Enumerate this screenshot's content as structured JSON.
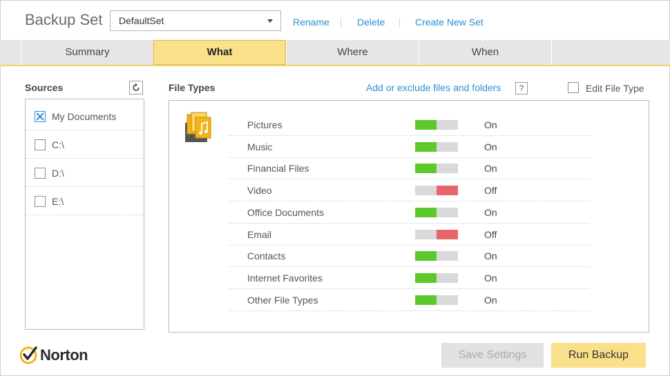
{
  "header": {
    "title": "Backup Set",
    "backup_set_selected": "DefaultSet",
    "links": {
      "rename": "Rename",
      "delete": "Delete",
      "create_new_set": "Create New Set"
    }
  },
  "tabs": [
    {
      "label": "Summary",
      "active": false
    },
    {
      "label": "What",
      "active": true
    },
    {
      "label": "Where",
      "active": false
    },
    {
      "label": "When",
      "active": false
    }
  ],
  "sources": {
    "heading": "Sources",
    "refresh_icon": "refresh-icon",
    "items": [
      {
        "label": "My Documents",
        "checked": true
      },
      {
        "label": "C:\\",
        "checked": false
      },
      {
        "label": "D:\\",
        "checked": false
      },
      {
        "label": "E:\\",
        "checked": false
      }
    ]
  },
  "file_types": {
    "heading": "File Types",
    "add_exclude_link": "Add or exclude files and folders",
    "help_label": "?",
    "edit_file_type_label": "Edit File Type",
    "icon": "documents-music-icon",
    "rows": [
      {
        "name": "Pictures",
        "state": "On"
      },
      {
        "name": "Music",
        "state": "On"
      },
      {
        "name": "Financial Files",
        "state": "On"
      },
      {
        "name": "Video",
        "state": "Off"
      },
      {
        "name": "Office Documents",
        "state": "On"
      },
      {
        "name": "Email",
        "state": "Off"
      },
      {
        "name": "Contacts",
        "state": "On"
      },
      {
        "name": "Internet Favorites",
        "state": "On"
      },
      {
        "name": "Other File Types",
        "state": "On"
      }
    ]
  },
  "footer": {
    "brand": "Norton",
    "save_settings_label": "Save Settings",
    "run_backup_label": "Run Backup"
  },
  "colors": {
    "accent_yellow": "#fbe08b",
    "link_blue": "#2a8fd0",
    "toggle_on_green": "#5bc92a",
    "toggle_off_red": "#e8666a",
    "norton_check": "#f3b41b"
  }
}
